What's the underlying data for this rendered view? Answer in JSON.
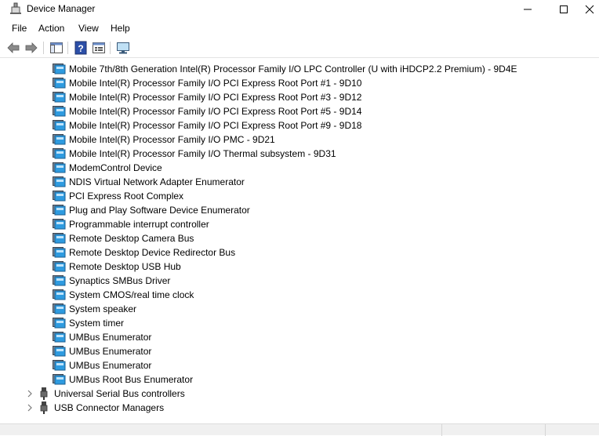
{
  "window": {
    "title": "Device Manager",
    "icon": "device-manager-icon"
  },
  "menu": {
    "items": [
      "File",
      "Action",
      "View",
      "Help"
    ]
  },
  "toolbar": {
    "buttons": [
      "back-arrow-icon",
      "forward-arrow-icon",
      "show-hide-console-tree-icon",
      "help-icon",
      "properties-icon",
      "scan-hardware-monitor-icon"
    ]
  },
  "tree": {
    "devices": [
      "Mobile 7th/8th Generation Intel(R) Processor Family I/O LPC Controller (U with iHDCP2.2 Premium) - 9D4E",
      "Mobile Intel(R) Processor Family I/O PCI Express Root Port #1 - 9D10",
      "Mobile Intel(R) Processor Family I/O PCI Express Root Port #3 - 9D12",
      "Mobile Intel(R) Processor Family I/O PCI Express Root Port #5 - 9D14",
      "Mobile Intel(R) Processor Family I/O PCI Express Root Port #9 - 9D18",
      "Mobile Intel(R) Processor Family I/O PMC - 9D21",
      "Mobile Intel(R) Processor Family I/O Thermal subsystem - 9D31",
      "ModemControl Device",
      "NDIS Virtual Network Adapter Enumerator",
      "PCI Express Root Complex",
      "Plug and Play Software Device Enumerator",
      "Programmable interrupt controller",
      "Remote Desktop Camera Bus",
      "Remote Desktop Device Redirector Bus",
      "Remote Desktop USB Hub",
      "Synaptics SMBus Driver",
      "System CMOS/real time clock",
      "System speaker",
      "System timer",
      "UMBus Enumerator",
      "UMBus Enumerator",
      "UMBus Enumerator",
      "UMBus Root Bus Enumerator"
    ],
    "categories": [
      "Universal Serial Bus controllers",
      "USB Connector Managers"
    ]
  }
}
